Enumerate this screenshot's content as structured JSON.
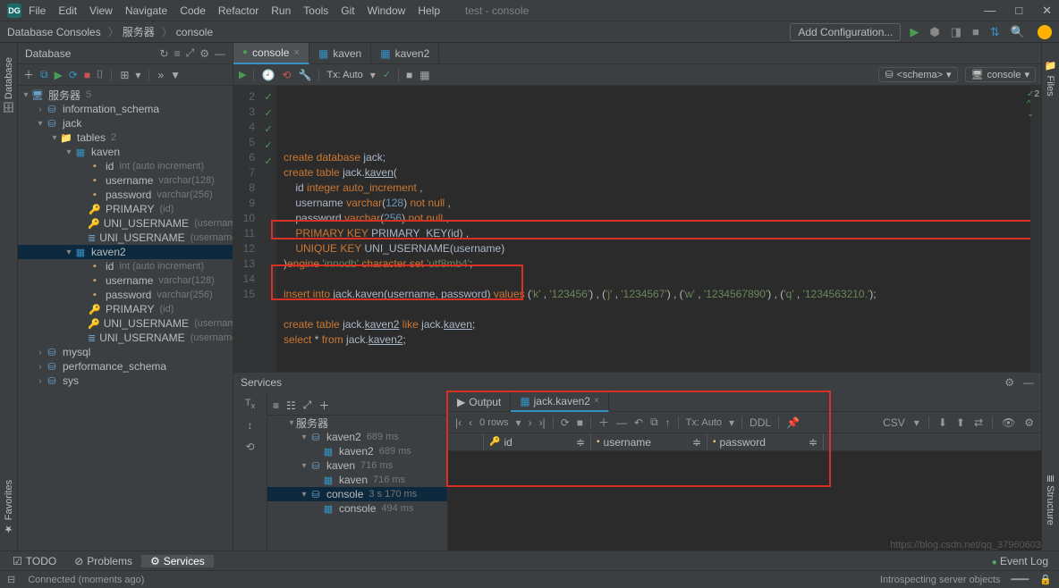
{
  "menu": {
    "items": [
      "File",
      "Edit",
      "View",
      "Navigate",
      "Code",
      "Refactor",
      "Run",
      "Tools",
      "Git",
      "Window",
      "Help"
    ],
    "title": "test - console"
  },
  "breadcrumbs": [
    "Database Consoles",
    "服务器",
    "console"
  ],
  "nav_right": {
    "config": "Add Configuration..."
  },
  "db_panel": {
    "title": "Database",
    "tree": {
      "server": {
        "label": "服务器",
        "meta": "5",
        "children": [
          {
            "label": "information_schema",
            "icon": "db"
          },
          {
            "label": "jack",
            "icon": "db",
            "children": [
              {
                "label": "tables",
                "meta": "2",
                "icon": "folder",
                "children": [
                  {
                    "label": "kaven",
                    "icon": "table",
                    "children": [
                      {
                        "label": "id",
                        "meta": "int (auto increment)",
                        "icon": "col"
                      },
                      {
                        "label": "username",
                        "meta": "varchar(128)",
                        "icon": "col"
                      },
                      {
                        "label": "password",
                        "meta": "varchar(256)",
                        "icon": "col"
                      },
                      {
                        "label": "PRIMARY",
                        "meta": "(id)",
                        "icon": "key"
                      },
                      {
                        "label": "UNI_USERNAME",
                        "meta": "(username)",
                        "icon": "key"
                      },
                      {
                        "label": "UNI_USERNAME",
                        "meta": "(username) UNIQUE",
                        "icon": "idx"
                      }
                    ]
                  },
                  {
                    "label": "kaven2",
                    "icon": "table",
                    "children": [
                      {
                        "label": "id",
                        "meta": "int (auto increment)",
                        "icon": "col"
                      },
                      {
                        "label": "username",
                        "meta": "varchar(128)",
                        "icon": "col"
                      },
                      {
                        "label": "password",
                        "meta": "varchar(256)",
                        "icon": "col"
                      },
                      {
                        "label": "PRIMARY",
                        "meta": "(id)",
                        "icon": "key"
                      },
                      {
                        "label": "UNI_USERNAME",
                        "meta": "(username)",
                        "icon": "key"
                      },
                      {
                        "label": "UNI_USERNAME",
                        "meta": "(username) UNIQUE",
                        "icon": "idx"
                      }
                    ]
                  }
                ]
              }
            ]
          },
          {
            "label": "mysql",
            "icon": "db"
          },
          {
            "label": "performance_schema",
            "icon": "db"
          },
          {
            "label": "sys",
            "icon": "db"
          }
        ]
      }
    }
  },
  "editor": {
    "tabs": [
      {
        "label": "console",
        "active": true,
        "icon": "●"
      },
      {
        "label": "kaven",
        "active": false
      },
      {
        "label": "kaven2",
        "active": false
      }
    ],
    "toolbar": {
      "txauto": "Tx: Auto",
      "schema": "<schema>",
      "session": "console"
    },
    "code_lines": [
      {
        "n": 2,
        "mark": "✓",
        "html": "<span class='kw'>create database</span> <span class='plain'>jack</span>;"
      },
      {
        "n": 3,
        "mark": "✓",
        "play": true,
        "html": "<span class='kw'>create table</span> <span class='plain'>jack</span>.<span class='plain u'>kaven</span>("
      },
      {
        "n": 4,
        "html": "    <span class='plain'>id</span> <span class='kw'>integer</span> <span class='kw'>auto_increment</span> ,"
      },
      {
        "n": 5,
        "html": "    <span class='plain'>username</span> <span class='kw'>varchar</span>(<span class='num'>128</span>) <span class='kw'>not null</span> ,"
      },
      {
        "n": 6,
        "html": "    <span class='plain'>password</span> <span class='kw'>varchar</span>(<span class='num'>256</span>) <span class='kw'>not null</span> ,"
      },
      {
        "n": 7,
        "html": "    <span class='kw'>PRIMARY KEY</span> <span class='plain'>PRIMARY_KEY</span>(<span class='plain'>id</span>) ,"
      },
      {
        "n": 8,
        "html": "    <span class='kw'>UNIQUE KEY</span> <span class='plain'>UNI_USERNAME</span>(<span class='plain'>username</span>)"
      },
      {
        "n": 9,
        "html": ")<span class='kw'>engine</span> <span class='str'>'innodb'</span> <span class='kw'>character set</span> <span class='str'>'utf8mb4'</span>;"
      },
      {
        "n": 10,
        "html": ""
      },
      {
        "n": 11,
        "mark": "✓",
        "html": "<span class='kw'>insert into</span> <span class='plain'>jack</span>.<span class='plain u'>kaven</span>(<span class='plain'>username</span>, <span class='plain'>password</span>) <span class='kw'>values</span> (<span class='str'>'k'</span> , <span class='str'>'123456'</span>) , (<span class='str'>'j'</span> , <span class='str'>'1234567'</span>) , (<span class='str'>'w'</span> , <span class='str'>'1234567890'</span>) , (<span class='str'>'q'</span> , <span class='str'>'1234563210.'</span>);"
      },
      {
        "n": 12,
        "html": ""
      },
      {
        "n": 13,
        "mark": "✓",
        "html": "<span class='kw'>create table</span> <span class='plain'>jack</span>.<span class='plain u'>kaven2</span> <span class='kw'>like</span> <span class='plain'>jack</span>.<span class='plain u'>kaven</span>;"
      },
      {
        "n": 14,
        "mark": "✓",
        "html": "<span class='kw'>select</span> * <span class='kw'>from</span> <span class='plain'>jack</span>.<span class='plain u'>kaven2</span>;"
      },
      {
        "n": 15,
        "html": ""
      }
    ],
    "problems": {
      "count": "2"
    }
  },
  "services": {
    "title": "Services",
    "tree": [
      {
        "label": "服务器",
        "indent": 1,
        "carrot": "▾"
      },
      {
        "label": "kaven2",
        "meta": "689 ms",
        "indent": 2,
        "carrot": "▾",
        "icon": "db"
      },
      {
        "label": "kaven2",
        "meta": "689 ms",
        "indent": 3,
        "icon": "table"
      },
      {
        "label": "kaven",
        "meta": "716 ms",
        "indent": 2,
        "carrot": "▾",
        "icon": "db"
      },
      {
        "label": "kaven",
        "meta": "716 ms",
        "indent": 3,
        "icon": "table"
      },
      {
        "label": "console",
        "meta": "3 s 170 ms",
        "indent": 2,
        "carrot": "▾",
        "icon": "db",
        "sel": true
      },
      {
        "label": "console",
        "meta": "494 ms",
        "indent": 3,
        "icon": "table"
      }
    ],
    "result_tabs": [
      {
        "label": "Output"
      },
      {
        "label": "jack.kaven2",
        "close": true,
        "active": true
      }
    ],
    "result_toolbar": {
      "rows": "0 rows",
      "tx": "Tx: Auto",
      "ddl": "DDL",
      "csv": "CSV"
    },
    "grid_cols": [
      "id",
      "username",
      "password"
    ]
  },
  "bottom_tabs": [
    {
      "label": "TODO",
      "icon": "☑"
    },
    {
      "label": "Problems",
      "icon": "⊘"
    },
    {
      "label": "Services",
      "icon": "⚙",
      "active": true
    }
  ],
  "status": {
    "left": "Connected (moments ago)",
    "center": "Introspecting server objects",
    "eventlog": "Event Log"
  },
  "watermark": "https://blog.csdn.net/qq_37960603"
}
